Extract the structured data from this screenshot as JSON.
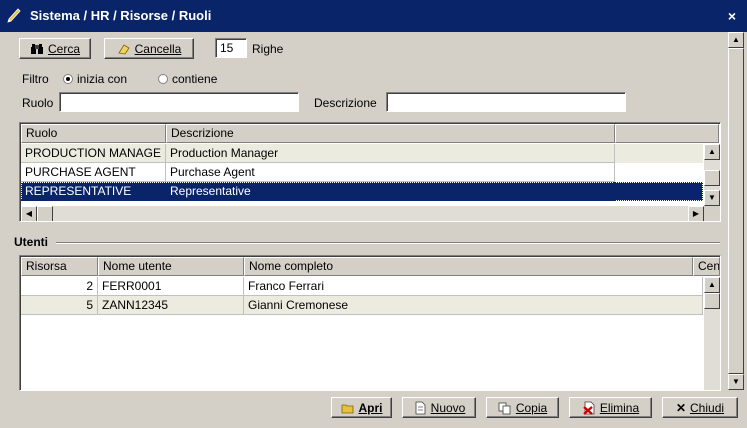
{
  "window": {
    "title": "Sistema / HR / Risorse / Ruoli",
    "close_glyph": "×",
    "icon": "pen-icon"
  },
  "toolbar": {
    "search_label": "Cerca",
    "clear_label": "Cancella",
    "rows_value": "15",
    "rows_label": "Righe"
  },
  "filter": {
    "label": "Filtro",
    "option_starts": "inizia con",
    "option_contains": "contiene",
    "selected": "inizia con",
    "ruolo_label": "Ruolo",
    "ruolo_value": "",
    "descr_label": "Descrizione",
    "descr_value": ""
  },
  "roles": {
    "columns": [
      "Ruolo",
      "Descrizione"
    ],
    "rows": [
      {
        "ruolo": "PRODUCTION MANAGE",
        "descrizione": "Production Manager"
      },
      {
        "ruolo": "PURCHASE AGENT",
        "descrizione": "Purchase Agent"
      },
      {
        "ruolo": "REPRESENTATIVE",
        "descrizione": "Representative"
      }
    ],
    "selected_row": 2
  },
  "users": {
    "section_title": "Utenti",
    "columns": [
      "Risorsa",
      "Nome utente",
      "Nome completo",
      "Cen"
    ],
    "rows": [
      {
        "risorsa": "2",
        "nome_utente": "FERR0001",
        "nome_completo": "Franco Ferrari"
      },
      {
        "risorsa": "5",
        "nome_utente": "ZANN12345",
        "nome_completo": "Gianni Cremonese"
      }
    ]
  },
  "actions": {
    "open": "Apri",
    "new": "Nuovo",
    "copy": "Copia",
    "delete": "Elimina",
    "close": "Chiudi"
  },
  "colors": {
    "titlebar": "#0a246a",
    "selection": "#0a246a",
    "face": "#d4d0c8",
    "alt_row": "#ecebdf"
  }
}
